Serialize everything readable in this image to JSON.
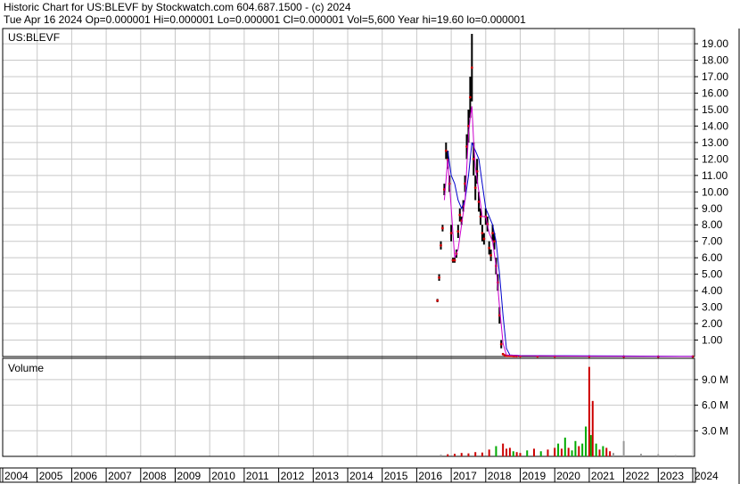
{
  "header": {
    "line1": "Historic Chart for US:BLEVF by Stockwatch.com 604.687.1500 - (c) 2024",
    "line2": "Tue Apr 16 2024   Op=0.000001   Hi=0.000001   Lo=0.000001   Cl=0.000001   Vol=5,600   Year hi=19.60   lo=0.000001"
  },
  "colors": {
    "grid": "#c8c8c8",
    "price_bars": "#000000",
    "price_dots": "#cc0000",
    "ma_short": "#cc00cc",
    "ma_long": "#0000cc",
    "vol_up": "#00aa00",
    "vol_down": "#cc0000",
    "vol_neutral": "#999999"
  },
  "chart_data": [
    {
      "type": "line",
      "title": "",
      "label": "US:BLEVF",
      "ylim": [
        0,
        19.6
      ],
      "y_ticks": [
        "1.00",
        "2.00",
        "3.00",
        "4.00",
        "5.00",
        "6.00",
        "7.00",
        "8.00",
        "9.00",
        "10.00",
        "11.00",
        "12.00",
        "13.00",
        "14.00",
        "15.00",
        "16.00",
        "17.00",
        "18.00",
        "19.00"
      ],
      "x_ticks": [
        "2004",
        "2005",
        "2006",
        "2007",
        "2008",
        "2009",
        "2010",
        "2011",
        "2012",
        "2013",
        "2014",
        "2015",
        "2016",
        "2017",
        "2018",
        "2019",
        "2020",
        "2021",
        "2022",
        "2023",
        "2024"
      ],
      "grid": true,
      "series": [
        {
          "role": "daily_range",
          "x": [
            2016.6,
            2016.65,
            2016.7,
            2016.75,
            2016.8,
            2016.85,
            2016.9,
            2016.95,
            2017.0,
            2017.05,
            2017.1,
            2017.15,
            2017.2,
            2017.25,
            2017.3,
            2017.35,
            2017.4,
            2017.45,
            2017.5,
            2017.55,
            2017.6,
            2017.65,
            2017.7,
            2017.75,
            2017.8,
            2017.85,
            2017.9,
            2017.95,
            2018.0,
            2018.05,
            2018.1,
            2018.15,
            2018.2,
            2018.25,
            2018.3,
            2018.35,
            2018.4,
            2018.45,
            2018.5,
            2018.55,
            2018.6,
            2018.65,
            2018.7,
            2018.75,
            2018.8,
            2018.85,
            2018.9,
            2019.0,
            2019.5,
            2020.0,
            2021.0,
            2022.0,
            2023.0,
            2024.0
          ],
          "values": [
            3.5,
            5.0,
            7.0,
            8.0,
            10.5,
            13.0,
            12.5,
            11.0,
            8.0,
            6.0,
            6.0,
            6.5,
            8.0,
            9.0,
            8.5,
            9.5,
            11.0,
            13.5,
            15.0,
            17.0,
            19.6,
            13.0,
            11.0,
            12.0,
            10.0,
            9.0,
            8.0,
            7.5,
            9.0,
            8.5,
            7.0,
            6.5,
            8.0,
            7.5,
            6.0,
            5.0,
            3.0,
            1.0,
            0.2,
            0.1,
            0.05,
            0.05,
            0.05,
            0.05,
            0.04,
            0.04,
            0.03,
            0.02,
            0.01,
            0.01,
            0.005,
            0.001,
            1e-06,
            1e-06
          ],
          "lows": [
            3.3,
            4.6,
            6.5,
            7.6,
            9.8,
            12.0,
            11.4,
            10.0,
            7.0,
            5.7,
            5.7,
            6.0,
            7.2,
            8.2,
            8.0,
            8.8,
            10.0,
            12.0,
            13.0,
            14.5,
            15.5,
            11.0,
            9.5,
            10.5,
            8.8,
            8.0,
            7.0,
            6.8,
            8.0,
            7.6,
            6.2,
            5.8,
            7.0,
            6.5,
            5.0,
            4.0,
            2.0,
            0.5,
            0.1,
            0.05,
            0.03,
            0.03,
            0.03,
            0.03,
            0.02,
            0.02,
            0.02,
            0.01,
            0.005,
            0.005,
            0.002,
            0.0005,
            1e-06,
            1e-06
          ]
        },
        {
          "role": "moving_average_short",
          "x": [
            2016.8,
            2016.9,
            2017.0,
            2017.1,
            2017.2,
            2017.3,
            2017.4,
            2017.5,
            2017.55,
            2017.6,
            2017.65,
            2017.7,
            2017.8,
            2017.9,
            2018.0,
            2018.1,
            2018.2,
            2018.3,
            2018.4,
            2018.5,
            2018.6,
            2019.0,
            2020.0,
            2021.0,
            2022.0,
            2023.0,
            2024.0
          ],
          "values": [
            9.5,
            12.0,
            9.0,
            6.0,
            6.5,
            8.0,
            9.5,
            13.5,
            14.5,
            15.2,
            13.0,
            11.5,
            10.0,
            8.5,
            8.5,
            7.5,
            7.0,
            5.5,
            3.0,
            0.8,
            0.1,
            0.05,
            0.03,
            0.02,
            0.01,
            0.005,
            0.001
          ]
        },
        {
          "role": "moving_average_long",
          "x": [
            2016.9,
            2017.0,
            2017.1,
            2017.2,
            2017.3,
            2017.4,
            2017.5,
            2017.6,
            2017.7,
            2017.8,
            2017.9,
            2018.0,
            2018.1,
            2018.2,
            2018.3,
            2018.4,
            2018.5,
            2018.6,
            2018.7,
            2018.8,
            2019.0,
            2020.0,
            2021.0,
            2022.0,
            2023.0,
            2024.0
          ],
          "values": [
            12.5,
            11.0,
            10.5,
            9.5,
            9.0,
            9.5,
            11.0,
            13.0,
            12.5,
            12.0,
            10.5,
            9.0,
            8.5,
            8.0,
            7.0,
            5.0,
            2.5,
            0.5,
            0.1,
            0.08,
            0.06,
            0.05,
            0.04,
            0.03,
            0.02,
            0.01
          ]
        }
      ]
    },
    {
      "type": "bar",
      "title": "",
      "label": "Volume",
      "ylim": [
        0,
        11500000
      ],
      "y_ticks": [
        "3.0 M",
        "6.0 M",
        "9.0 M"
      ],
      "grid": true,
      "x": [
        2016.7,
        2016.9,
        2017.1,
        2017.3,
        2017.5,
        2017.7,
        2017.9,
        2018.1,
        2018.3,
        2018.5,
        2018.6,
        2018.7,
        2018.8,
        2018.9,
        2019.0,
        2019.2,
        2019.4,
        2019.6,
        2019.8,
        2020.0,
        2020.1,
        2020.2,
        2020.3,
        2020.4,
        2020.5,
        2020.6,
        2020.7,
        2020.8,
        2020.9,
        2021.0,
        2021.05,
        2021.1,
        2021.2,
        2021.3,
        2021.4,
        2021.5,
        2021.6,
        2021.7,
        2022.0,
        2022.5,
        2023.0,
        2023.5,
        2024.0
      ],
      "values": [
        200000,
        250000,
        300000,
        400000,
        350000,
        500000,
        450000,
        800000,
        1200000,
        1500000,
        900000,
        1000000,
        600000,
        500000,
        400000,
        700000,
        900000,
        600000,
        800000,
        1000000,
        1500000,
        900000,
        2200000,
        1000000,
        700000,
        1800000,
        1200000,
        1500000,
        3500000,
        10500000,
        2500000,
        6500000,
        1500000,
        800000,
        1200000,
        1000000,
        600000,
        400000,
        1800000,
        300000,
        250000,
        150000,
        100000
      ],
      "direction": [
        "neutral",
        "down",
        "down",
        "down",
        "down",
        "down",
        "down",
        "down",
        "up",
        "down",
        "down",
        "down",
        "up",
        "down",
        "down",
        "up",
        "down",
        "up",
        "down",
        "down",
        "up",
        "down",
        "up",
        "down",
        "up",
        "up",
        "down",
        "up",
        "up",
        "down",
        "up",
        "down",
        "up",
        "down",
        "up",
        "down",
        "down",
        "neutral",
        "neutral",
        "neutral",
        "neutral",
        "neutral",
        "neutral"
      ]
    }
  ]
}
